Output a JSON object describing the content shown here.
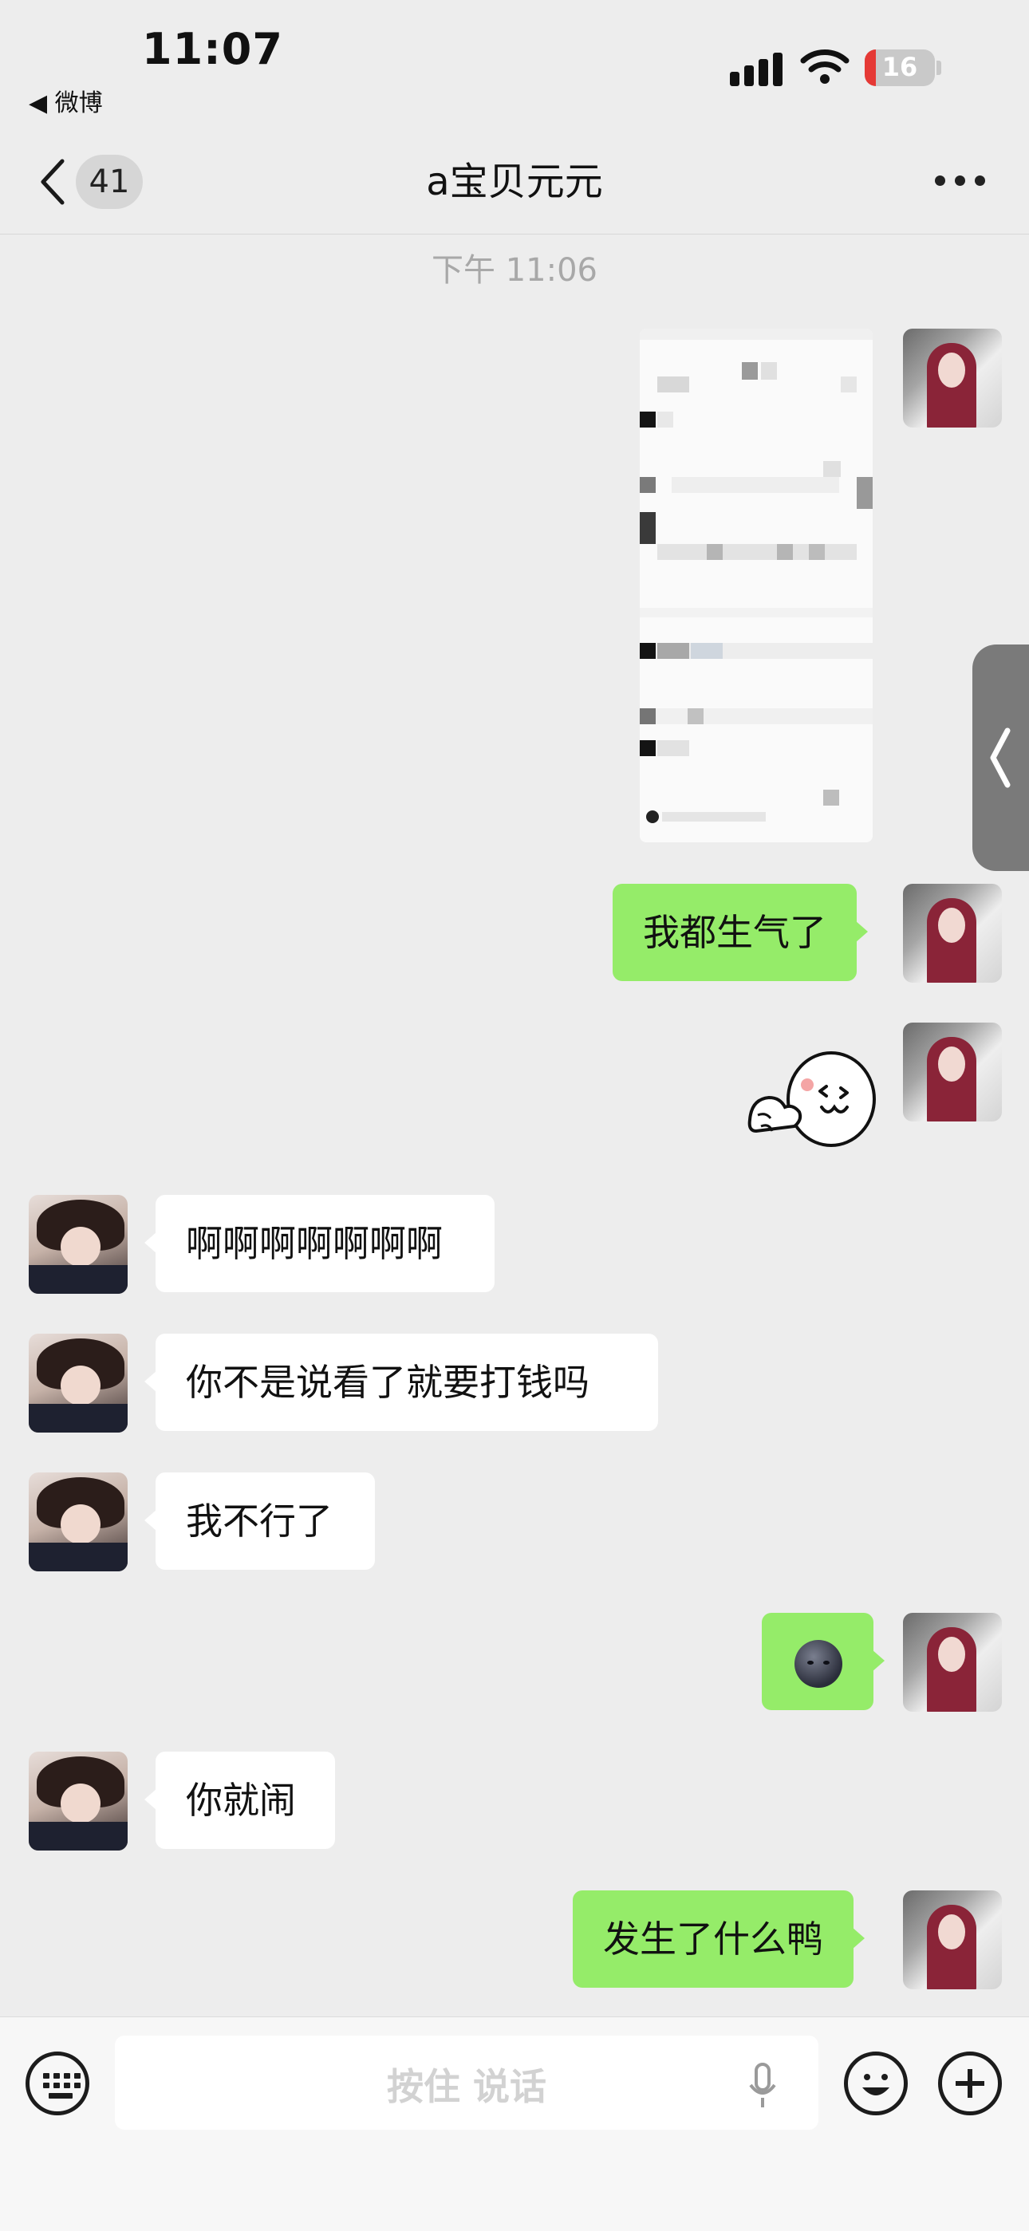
{
  "status_bar": {
    "time": "11:07",
    "back_app": "◀ 微博",
    "battery": "16",
    "icons": [
      "cellular-signal-icon",
      "wifi-icon",
      "battery-icon"
    ]
  },
  "nav": {
    "unread_count": "41",
    "title": "a宝贝元元",
    "icons": [
      "chevron-left-icon",
      "more-icon"
    ]
  },
  "chat": {
    "timestamp": "下午 11:06",
    "messages": [
      {
        "side": "out",
        "type": "image",
        "text": ""
      },
      {
        "side": "out",
        "type": "text",
        "text": "我都生气了"
      },
      {
        "side": "out",
        "type": "sticker",
        "text": ""
      },
      {
        "side": "in",
        "type": "text",
        "text": "啊啊啊啊啊啊啊"
      },
      {
        "side": "in",
        "type": "text",
        "text": "你不是说看了就要打钱吗"
      },
      {
        "side": "in",
        "type": "text",
        "text": "我不行了"
      },
      {
        "side": "out",
        "type": "emoji",
        "emoji": "new-moon-face-icon"
      },
      {
        "side": "in",
        "type": "text",
        "text": "你就闹"
      },
      {
        "side": "out",
        "type": "text",
        "text": "发生了什么鸭"
      }
    ]
  },
  "input_bar": {
    "voice_label": "按住 说话",
    "icons": [
      "keyboard-icon",
      "microphone-icon",
      "emoji-icon",
      "plus-icon"
    ]
  },
  "colors": {
    "background": "#ededed",
    "outgoing_bubble": "#95ec69",
    "incoming_bubble": "#ffffff"
  }
}
